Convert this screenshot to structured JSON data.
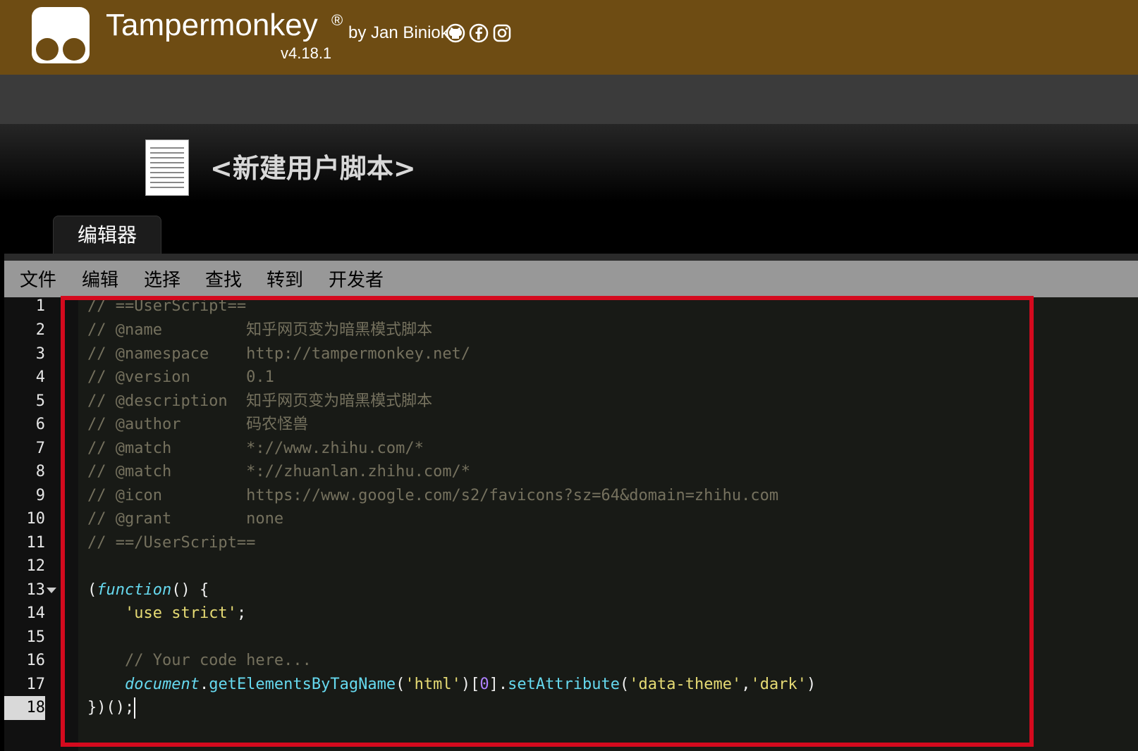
{
  "header": {
    "app_name": "Tampermonkey",
    "registered_mark": "®",
    "byline": "by Jan Biniok",
    "version": "v4.18.1",
    "social_icons": [
      "github-icon",
      "facebook-icon",
      "instagram-icon"
    ]
  },
  "script": {
    "title": "<新建用户脚本>"
  },
  "tabs": [
    {
      "label": "编辑器",
      "active": true
    }
  ],
  "menu": {
    "items": [
      "文件",
      "编辑",
      "选择",
      "查找",
      "转到",
      "开发者"
    ]
  },
  "editor": {
    "active_line": 18,
    "line_numbers": [
      "1",
      "2",
      "3",
      "4",
      "5",
      "6",
      "7",
      "8",
      "9",
      "10",
      "11",
      "12",
      "13",
      "14",
      "15",
      "16",
      "17",
      "18"
    ],
    "lines": {
      "l1": "// ==UserScript==",
      "l2": "// @name         知乎网页变为暗黑模式脚本",
      "l3": "// @namespace    http://tampermonkey.net/",
      "l4": "// @version      0.1",
      "l5": "// @description  知乎网页变为暗黑模式脚本",
      "l6": "// @author       码农怪兽",
      "l7": "// @match        *://www.zhihu.com/*",
      "l8": "// @match        *://zhuanlan.zhihu.com/*",
      "l9": "// @icon         https://www.google.com/s2/favicons?sz=64&domain=zhihu.com",
      "l10": "// @grant        none",
      "l11": "// ==/UserScript==",
      "l13_open": "(",
      "l13_keyword": "function",
      "l13_rest": "() {",
      "l14_indent": "    ",
      "l14_string": "'use strict'",
      "l14_end": ";",
      "l16_comment": "    // Your code here...",
      "l17_indent": "    ",
      "l17_object": "document",
      "l17_dot1": ".",
      "l17_method1": "getElementsByTagName",
      "l17_p1": "(",
      "l17_arg1": "'html'",
      "l17_p2": ")[",
      "l17_index": "0",
      "l17_p3": "].",
      "l17_method2": "setAttribute",
      "l17_p4": "(",
      "l17_arg2": "'data-theme'",
      "l17_comma": ",",
      "l17_arg3": "'dark'",
      "l17_p5": ")",
      "l18": "})();"
    }
  },
  "colors": {
    "brand_bar": "#6e4c13",
    "highlight_border": "#d40a1e",
    "comment": "#75715e",
    "string": "#e6db74",
    "keyword": "#66d9ef",
    "number": "#ae81ff"
  }
}
